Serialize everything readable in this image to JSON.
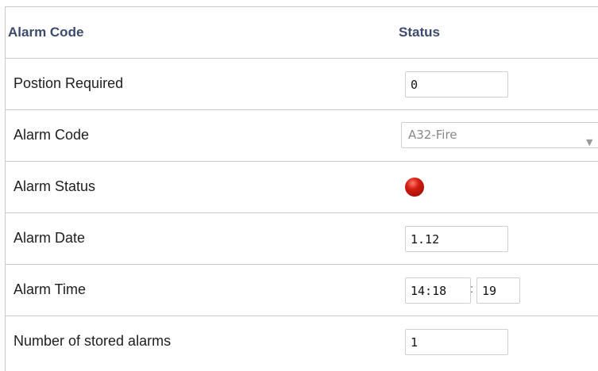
{
  "table": {
    "header": {
      "col_name": "Alarm Code",
      "col_status": "Status"
    },
    "rows": [
      {
        "label": "Postion Required",
        "value": "0"
      },
      {
        "label": "Alarm Code",
        "value": "A32-Fire"
      },
      {
        "label": "Alarm Status",
        "indicator": "red-led"
      },
      {
        "label": "Alarm Date",
        "value": "1.12"
      },
      {
        "label": "Alarm Time",
        "value_hm": "14:18",
        "value_s": "19"
      },
      {
        "label": "Number of stored alarms",
        "value": "1"
      }
    ]
  },
  "colors": {
    "header_text": "#3c4a6e",
    "led_red": "#d31c10",
    "border": "#c9c9c9"
  }
}
